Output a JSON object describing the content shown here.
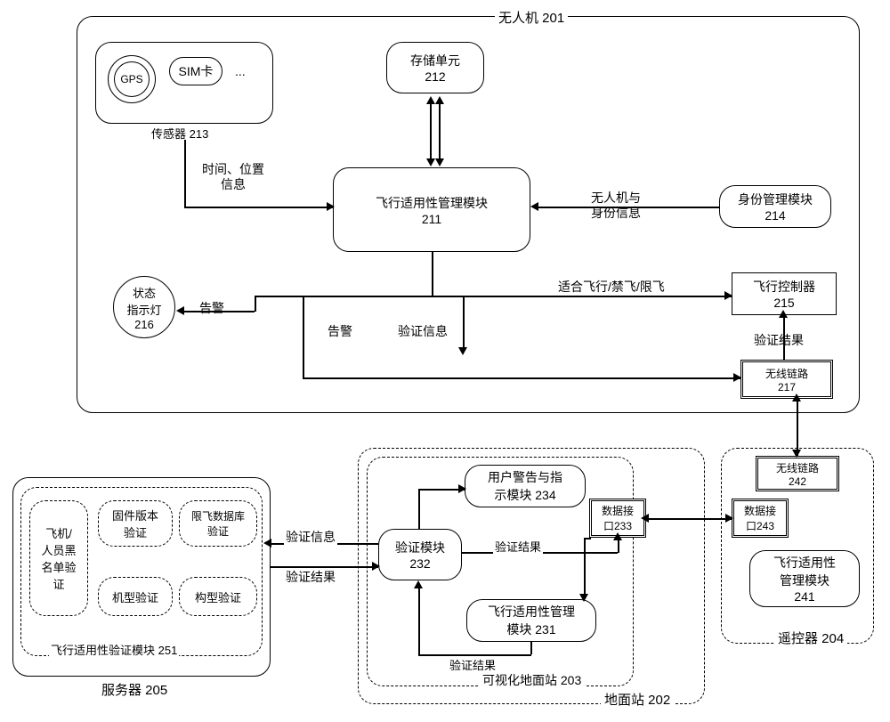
{
  "uav": {
    "title": "无人机 201",
    "sensor": {
      "title": "传感器 213",
      "gps": "GPS",
      "sim": "SIM卡",
      "dots": "..."
    },
    "storage": {
      "l1": "存储单元",
      "l2": "212"
    },
    "fam": {
      "l1": "飞行适用性管理模块",
      "l2": "211"
    },
    "identity": {
      "l1": "身份管理模块",
      "l2": "214"
    },
    "indicator": {
      "l1": "状态",
      "l2": "指示灯",
      "l3": "216"
    },
    "fc": {
      "l1": "飞行控制器",
      "l2": "215"
    },
    "wlink": {
      "l1": "无线链路",
      "l2": "217"
    }
  },
  "server": {
    "title": "服务器 205",
    "module_title": "飞行适用性验证模块  251",
    "blacklist": {
      "l1": "飞机/",
      "l2": "人员黑",
      "l3": "名单验",
      "l4": "证"
    },
    "firmware": {
      "l1": "固件版本",
      "l2": "验证"
    },
    "restrict": {
      "l1": "限飞数据库",
      "l2": "验证"
    },
    "model": "机型验证",
    "config": "构型验证"
  },
  "gs": {
    "outer_title": "地面站 202",
    "vis_title": "可视化地面站 203",
    "warn": {
      "l1": "用户警告与指",
      "l2": "示模块  234"
    },
    "verify": {
      "l1": "验证模块",
      "l2": "232"
    },
    "fam": {
      "l1": "飞行适用性管理",
      "l2": "模块 231"
    },
    "dataif": {
      "l1": "数据接",
      "l2": "口233"
    }
  },
  "rc": {
    "title": "遥控器 204",
    "wlink": {
      "l1": "无线链路",
      "l2": "242"
    },
    "dataif": {
      "l1": "数据接",
      "l2": "口243"
    },
    "fam": {
      "l1": "飞行适用性",
      "l2": "管理模块",
      "l3": "241"
    }
  },
  "labels": {
    "time_pos": {
      "l1": "时间、位置",
      "l2": "信息"
    },
    "id_info": {
      "l1": "无人机与",
      "l2": "身份信息"
    },
    "fly_status": "适合飞行/禁飞/限飞",
    "alarm": "告警",
    "verify_info": "验证信息",
    "verify_result": "验证结果"
  }
}
